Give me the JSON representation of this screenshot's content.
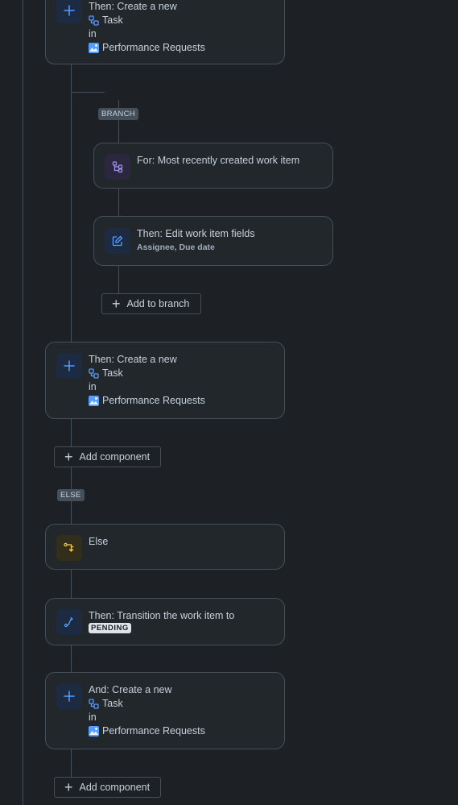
{
  "colors": {
    "background": "#1d2125",
    "card": "#22272b",
    "border": "#454f59",
    "text": "#c7d1db",
    "accent_blue": "#579dff",
    "accent_purple": "#9f8fef",
    "accent_yellow": "#f5cd47"
  },
  "card1": {
    "title": "Then: Create a new",
    "item_type": "Task",
    "in_label": "in",
    "project": "Performance Requests",
    "icon": "plus-icon"
  },
  "branch_pill": "BRANCH",
  "for_card": {
    "title": "For: Most recently created work item",
    "icon": "branch-icon"
  },
  "edit_card": {
    "title": "Then: Edit work item fields",
    "fields": "Assignee, Due date",
    "icon": "edit-icon"
  },
  "add_to_branch": {
    "label": "Add to branch"
  },
  "card2": {
    "title": "Then: Create a new",
    "item_type": "Task",
    "in_label": "in",
    "project": "Performance Requests",
    "icon": "plus-icon"
  },
  "add_component_1": {
    "label": "Add component"
  },
  "else_pill": "ELSE",
  "else_card": {
    "title": "Else",
    "icon": "condition-icon"
  },
  "transition_card": {
    "title": "Then: Transition the work item to",
    "status": "PENDING",
    "icon": "transition-icon"
  },
  "card3": {
    "title": "And: Create a new",
    "item_type": "Task",
    "in_label": "in",
    "project": "Performance Requests",
    "icon": "plus-icon"
  },
  "add_component_2": {
    "label": "Add component"
  }
}
